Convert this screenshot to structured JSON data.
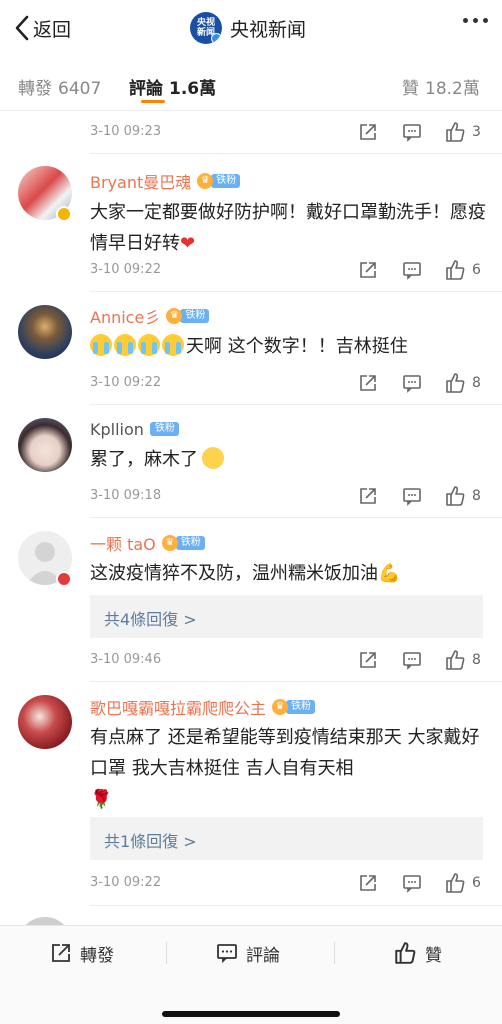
{
  "header": {
    "back_label": "返回",
    "logo_text": "央视新闻",
    "title": "央视新闻"
  },
  "tabs": [
    {
      "label": "轉發",
      "count": "6407"
    },
    {
      "label": "評論",
      "count": "1.6萬"
    },
    {
      "label": "贊",
      "count": "18.2萬"
    }
  ],
  "comments": [
    {
      "time": "3-10 09:23",
      "likes": "3"
    },
    {
      "username": "Bryant曼巴魂",
      "fan_badge": "铁粉",
      "text": "大家一定都要做好防护啊！戴好口罩勤洗手！愿疫情早日好转",
      "emoji": "❤",
      "time": "3-10 09:22",
      "likes": "6"
    },
    {
      "username": "Annice彡",
      "fan_badge": "铁粉",
      "text": "天啊 这个数字！！吉林挺住",
      "time": "3-10 09:22",
      "likes": "8"
    },
    {
      "username": "Kpllion",
      "fan_badge": "铁粉",
      "text": "累了，麻木了",
      "time": "3-10 09:18",
      "likes": "8"
    },
    {
      "username": "一颗 taO",
      "fan_badge": "铁粉",
      "text": "这波疫情猝不及防，温州糯米饭加油",
      "emoji": "💪",
      "reply_link": "共4條回復 >",
      "time": "3-10 09:46",
      "likes": "8"
    },
    {
      "username": "歌巴嘎霸嘎拉霸爬爬公主",
      "fan_badge": "铁粉",
      "text": "有点麻了 还是希望能等到疫情结束那天 大家戴好口罩 我大吉林挺住 吉人自有天相",
      "emoji": "🌹",
      "reply_link": "共1條回復 >",
      "time": "3-10 09:22",
      "likes": "6"
    }
  ],
  "bottom_bar": {
    "repost": "轉發",
    "comment": "評論",
    "like": "贊"
  },
  "colors": {
    "accent": "#ff8200",
    "username": "#eb7350",
    "link": "#5e7d9c",
    "heart": "#e8312f",
    "fan_badge": "#6ab0f3"
  }
}
